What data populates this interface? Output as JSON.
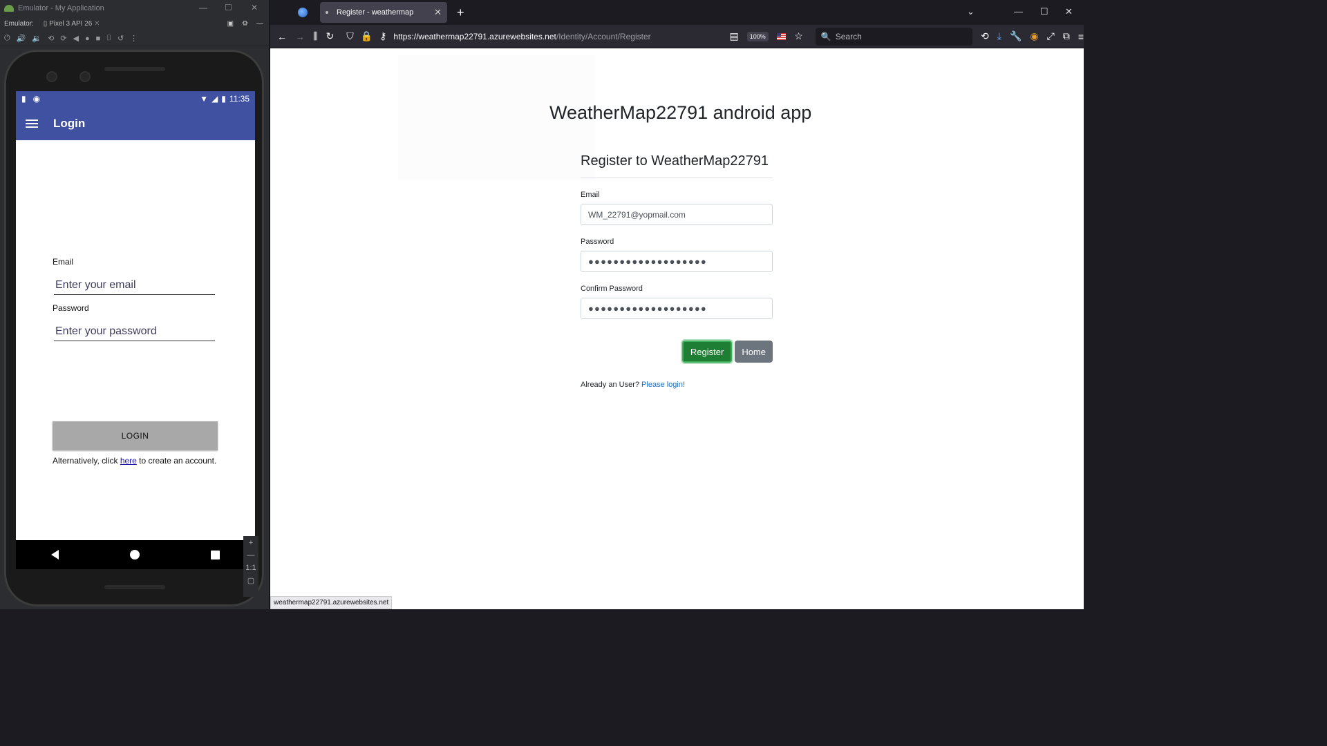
{
  "emulator": {
    "window_title": "Emulator - My Application",
    "toolbar_label": "Emulator:",
    "device_tab": "Pixel 3 API 26",
    "phone": {
      "status_time": "11:35",
      "app_title": "Login",
      "email_label": "Email",
      "email_placeholder": "Enter your email",
      "password_label": "Password",
      "password_placeholder": "Enter your password",
      "login_button": "LOGIN",
      "alt_prefix": "Alternatively, click ",
      "alt_link": "here",
      "alt_suffix": " to create an account."
    },
    "zoom_ratio": "1:1"
  },
  "browser": {
    "tab_title": "Register - weathermap",
    "url_host": "https://weathermap22791.azurewebsites.net",
    "url_path": "/Identity/Account/Register",
    "zoom": "100%",
    "search_placeholder": "Search",
    "status_url": "weathermap22791.azurewebsites.net"
  },
  "page": {
    "heading": "WeatherMap22791 android app",
    "form_title": "Register to WeatherMap22791",
    "email_label": "Email",
    "email_value": "WM_22791@yopmail.com",
    "password_label": "Password",
    "password_value": "●●●●●●●●●●●●●●●●●●●",
    "confirm_label": "Confirm Password",
    "confirm_value": "●●●●●●●●●●●●●●●●●●●",
    "register_button": "Register",
    "home_button": "Home",
    "already_text": "Already an User? ",
    "login_link": "Please login!"
  },
  "colors": {
    "app_bar": "#3f51a0",
    "register_green": "#1e7e34",
    "home_gray": "#6c757d",
    "link_blue": "#1b6ec2"
  }
}
